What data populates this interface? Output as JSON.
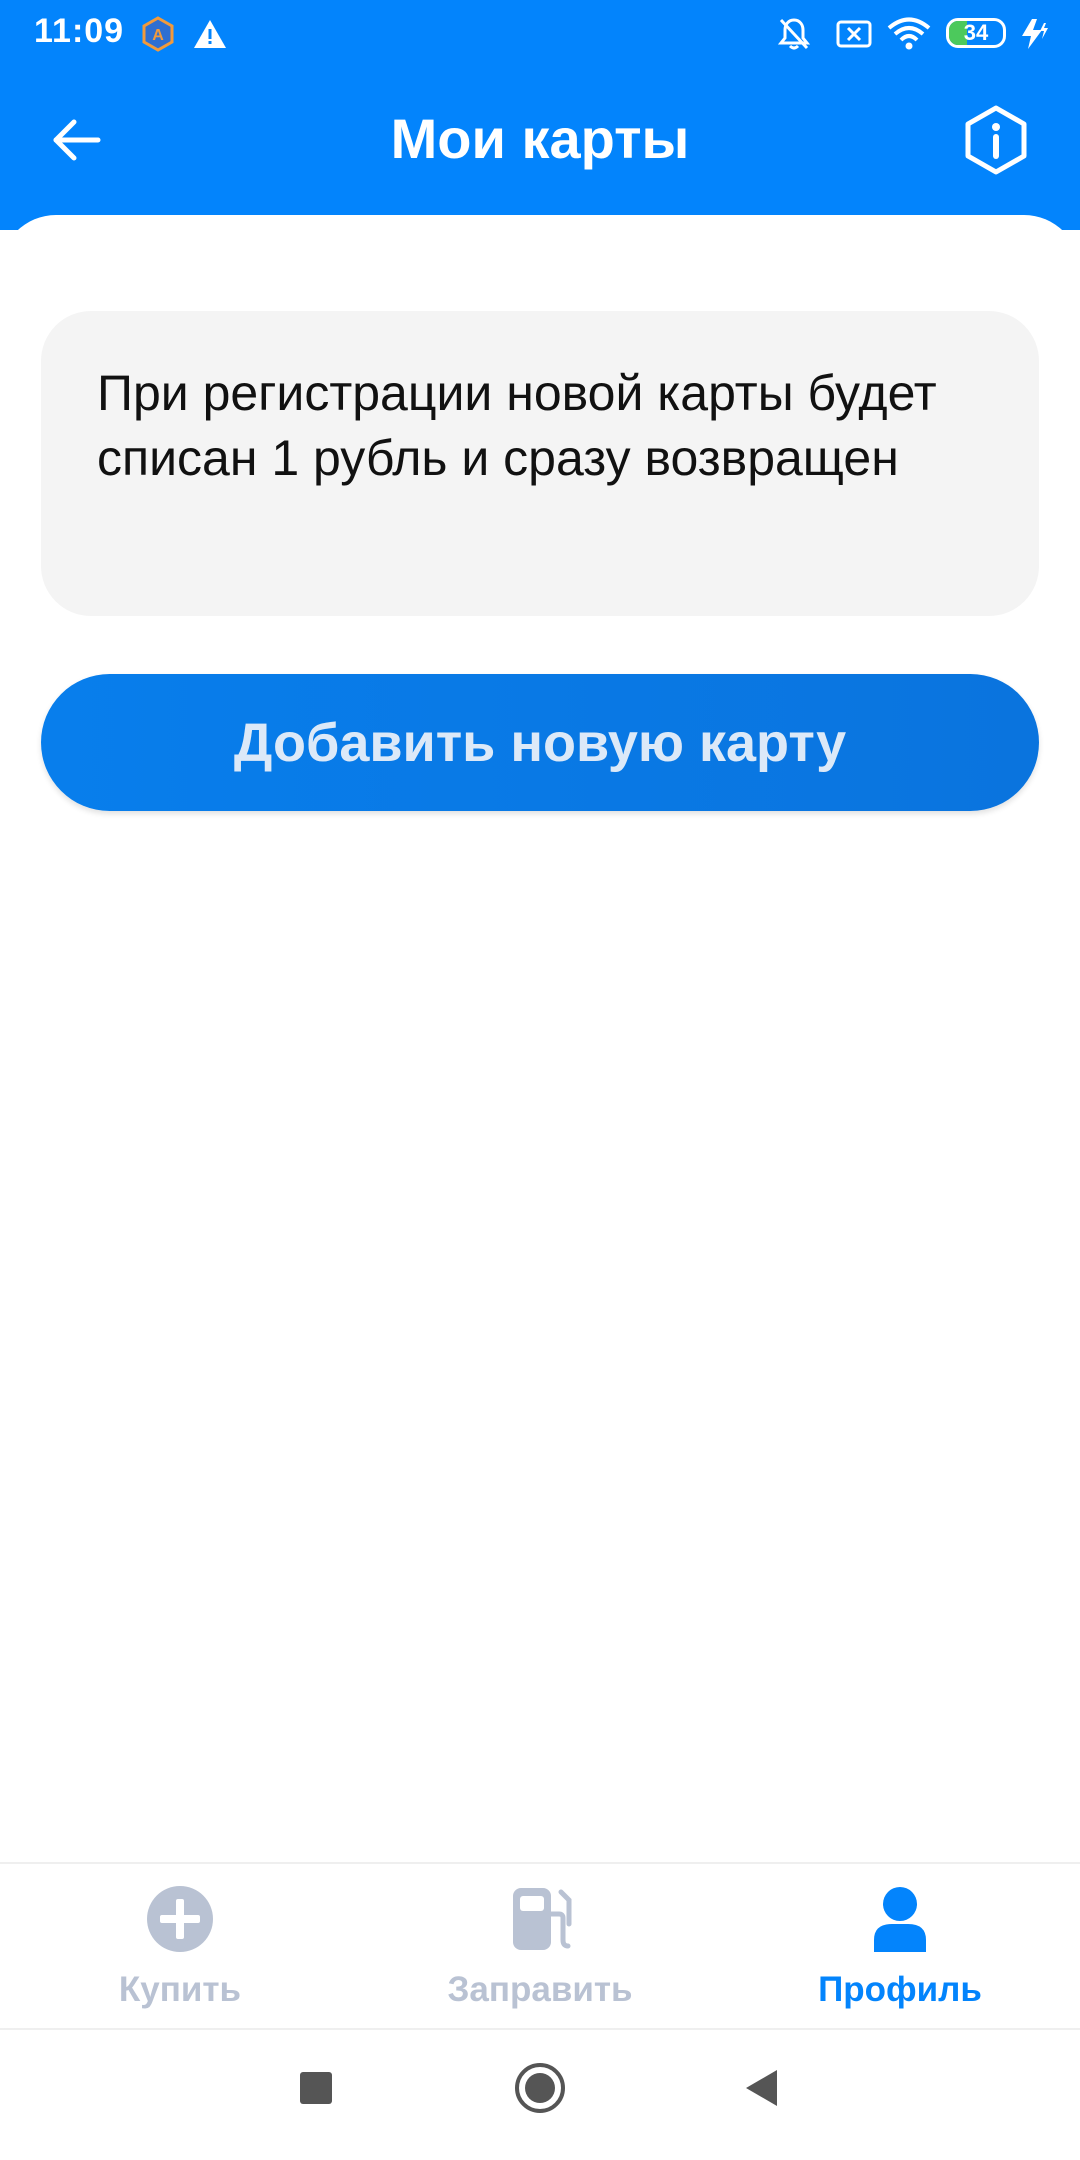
{
  "colors": {
    "header_bg": "#0384FC",
    "button_bg": "#0A78E4",
    "button_text": "#DCE9F8",
    "card_bg": "#F4F4F4",
    "nav_active": "#0384FC",
    "nav_inactive": "#B9C2D3",
    "battery_fill": "#4CC95C"
  },
  "status_bar": {
    "time": "11:09",
    "battery": "34",
    "battery_level": 0.34,
    "icons": [
      "app-notification-icon",
      "warning-icon",
      "mute-icon",
      "sim-off-icon",
      "wifi-icon",
      "battery-icon",
      "charging-icon"
    ]
  },
  "header": {
    "title": "Мои карты",
    "back_icon": "arrow-left-icon",
    "info_icon": "info-hexagon-icon"
  },
  "notice": {
    "text": "При регистрации новой карты будет списан 1 рубль и сразу возвращен"
  },
  "actions": {
    "add_card_label": "Добавить новую карту"
  },
  "bottom_nav": {
    "items": [
      {
        "label": "Купить",
        "icon": "plus-circle-icon",
        "active": false
      },
      {
        "label": "Заправить",
        "icon": "fuel-pump-icon",
        "active": false
      },
      {
        "label": "Профиль",
        "icon": "user-icon",
        "active": true
      }
    ]
  },
  "system_nav": {
    "icons": [
      "recents-square-icon",
      "home-circle-icon",
      "back-triangle-icon"
    ]
  }
}
